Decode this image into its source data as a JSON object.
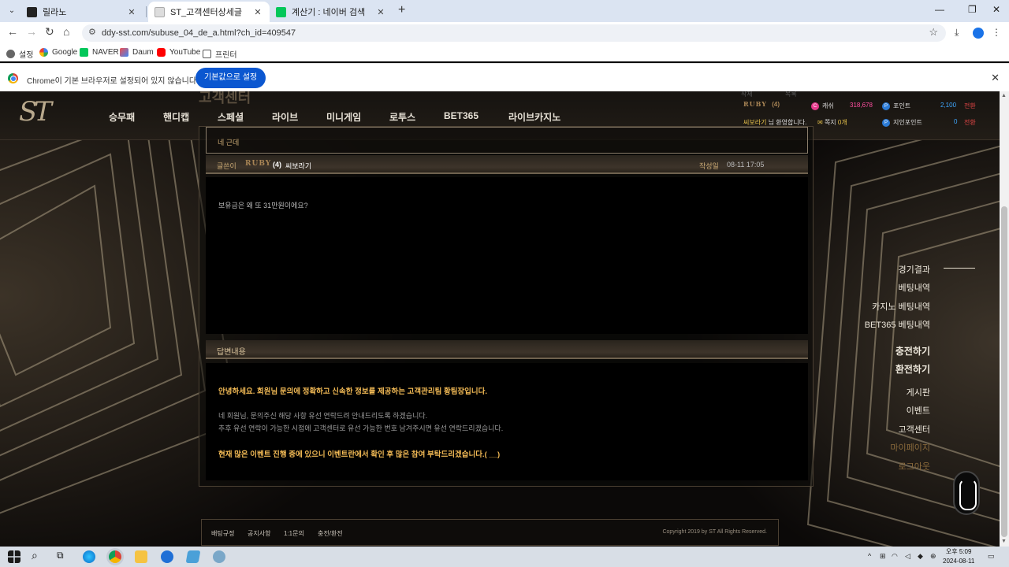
{
  "browser": {
    "tabs": [
      {
        "title": "릴라노",
        "active": false
      },
      {
        "title": "ST_고객센터상세글",
        "active": true
      },
      {
        "title": "계산기 : 네이버 검색",
        "active": false
      }
    ],
    "url": "ddy-sst.com/subuse_04_de_a.html?ch_id=409547",
    "bookmarks": [
      "설정",
      "Google",
      "NAVER",
      "Daum",
      "YouTube",
      "프린터"
    ],
    "infobar": {
      "message": "Chrome이 기본 브라우저로 설정되어 있지 않습니다",
      "button": "기본값으로 설정"
    }
  },
  "site": {
    "logo": "ST",
    "page_title": "고객센터",
    "nav": [
      "승무패",
      "핸디캡",
      "스페셜",
      "라이브",
      "미니게임",
      "로투스",
      "BET365",
      "라이브카지노"
    ],
    "user": {
      "grade": "RUBY",
      "level": "(4)",
      "nickname": "씨보라기",
      "welcome": "님 환영합니다.",
      "cash_label": "캐쉬",
      "cash_value": "318,678",
      "point_label": "포인트",
      "point_value": "2,100",
      "convert_label": "전환",
      "message_label": "쪽지",
      "message_value": "0개",
      "referral_label": "지인포인트",
      "referral_value": "0",
      "top_buttons": [
        "삭제",
        "목록"
      ]
    },
    "post": {
      "subject": "네 근데",
      "author_label": "글쓴이",
      "author_grade": "RUBY",
      "author_level": "(4)",
      "author_name": "씨보라기",
      "date_label": "작성일",
      "date_value": "08-11 17:05",
      "body": "보유금은 왜 또 31만원이에요?"
    },
    "reply": {
      "header": "답변내용",
      "greeting": "안녕하세요. 회원님 문의에 정확하고 신속한 정보를 제공하는 고객관리팀 황팀장입니다.",
      "line1": "네 회원님, 문의주신 해당 사항 유선 연락드려 안내드리도록 하겠습니다.",
      "line2": "추후 유선 연락이 가능한 시점에 고객센터로 유선 가능한 번호 남겨주시면 유선 연락드리겠습니다.",
      "closing": "현재 많은 이벤트 진행 중에 있으니 이벤트란에서 확인 후 많은 참여 부탁드리겠습니다.( __)"
    },
    "side_menu": [
      "경기결과",
      "베팅내역",
      "카지노 베팅내역",
      "BET365 베팅내역",
      "충전하기",
      "환전하기",
      "게시판",
      "이벤트",
      "고객센터",
      "마이페이지",
      "로그아웃"
    ],
    "footer": {
      "links": [
        "배팅규정",
        "공지사항",
        "1:1문의",
        "충전/환전"
      ],
      "copyright": "Copyright 2019 by ST All Rights Reserved."
    }
  },
  "taskbar": {
    "time": "오후 5:09",
    "date": "2024-08-11"
  }
}
